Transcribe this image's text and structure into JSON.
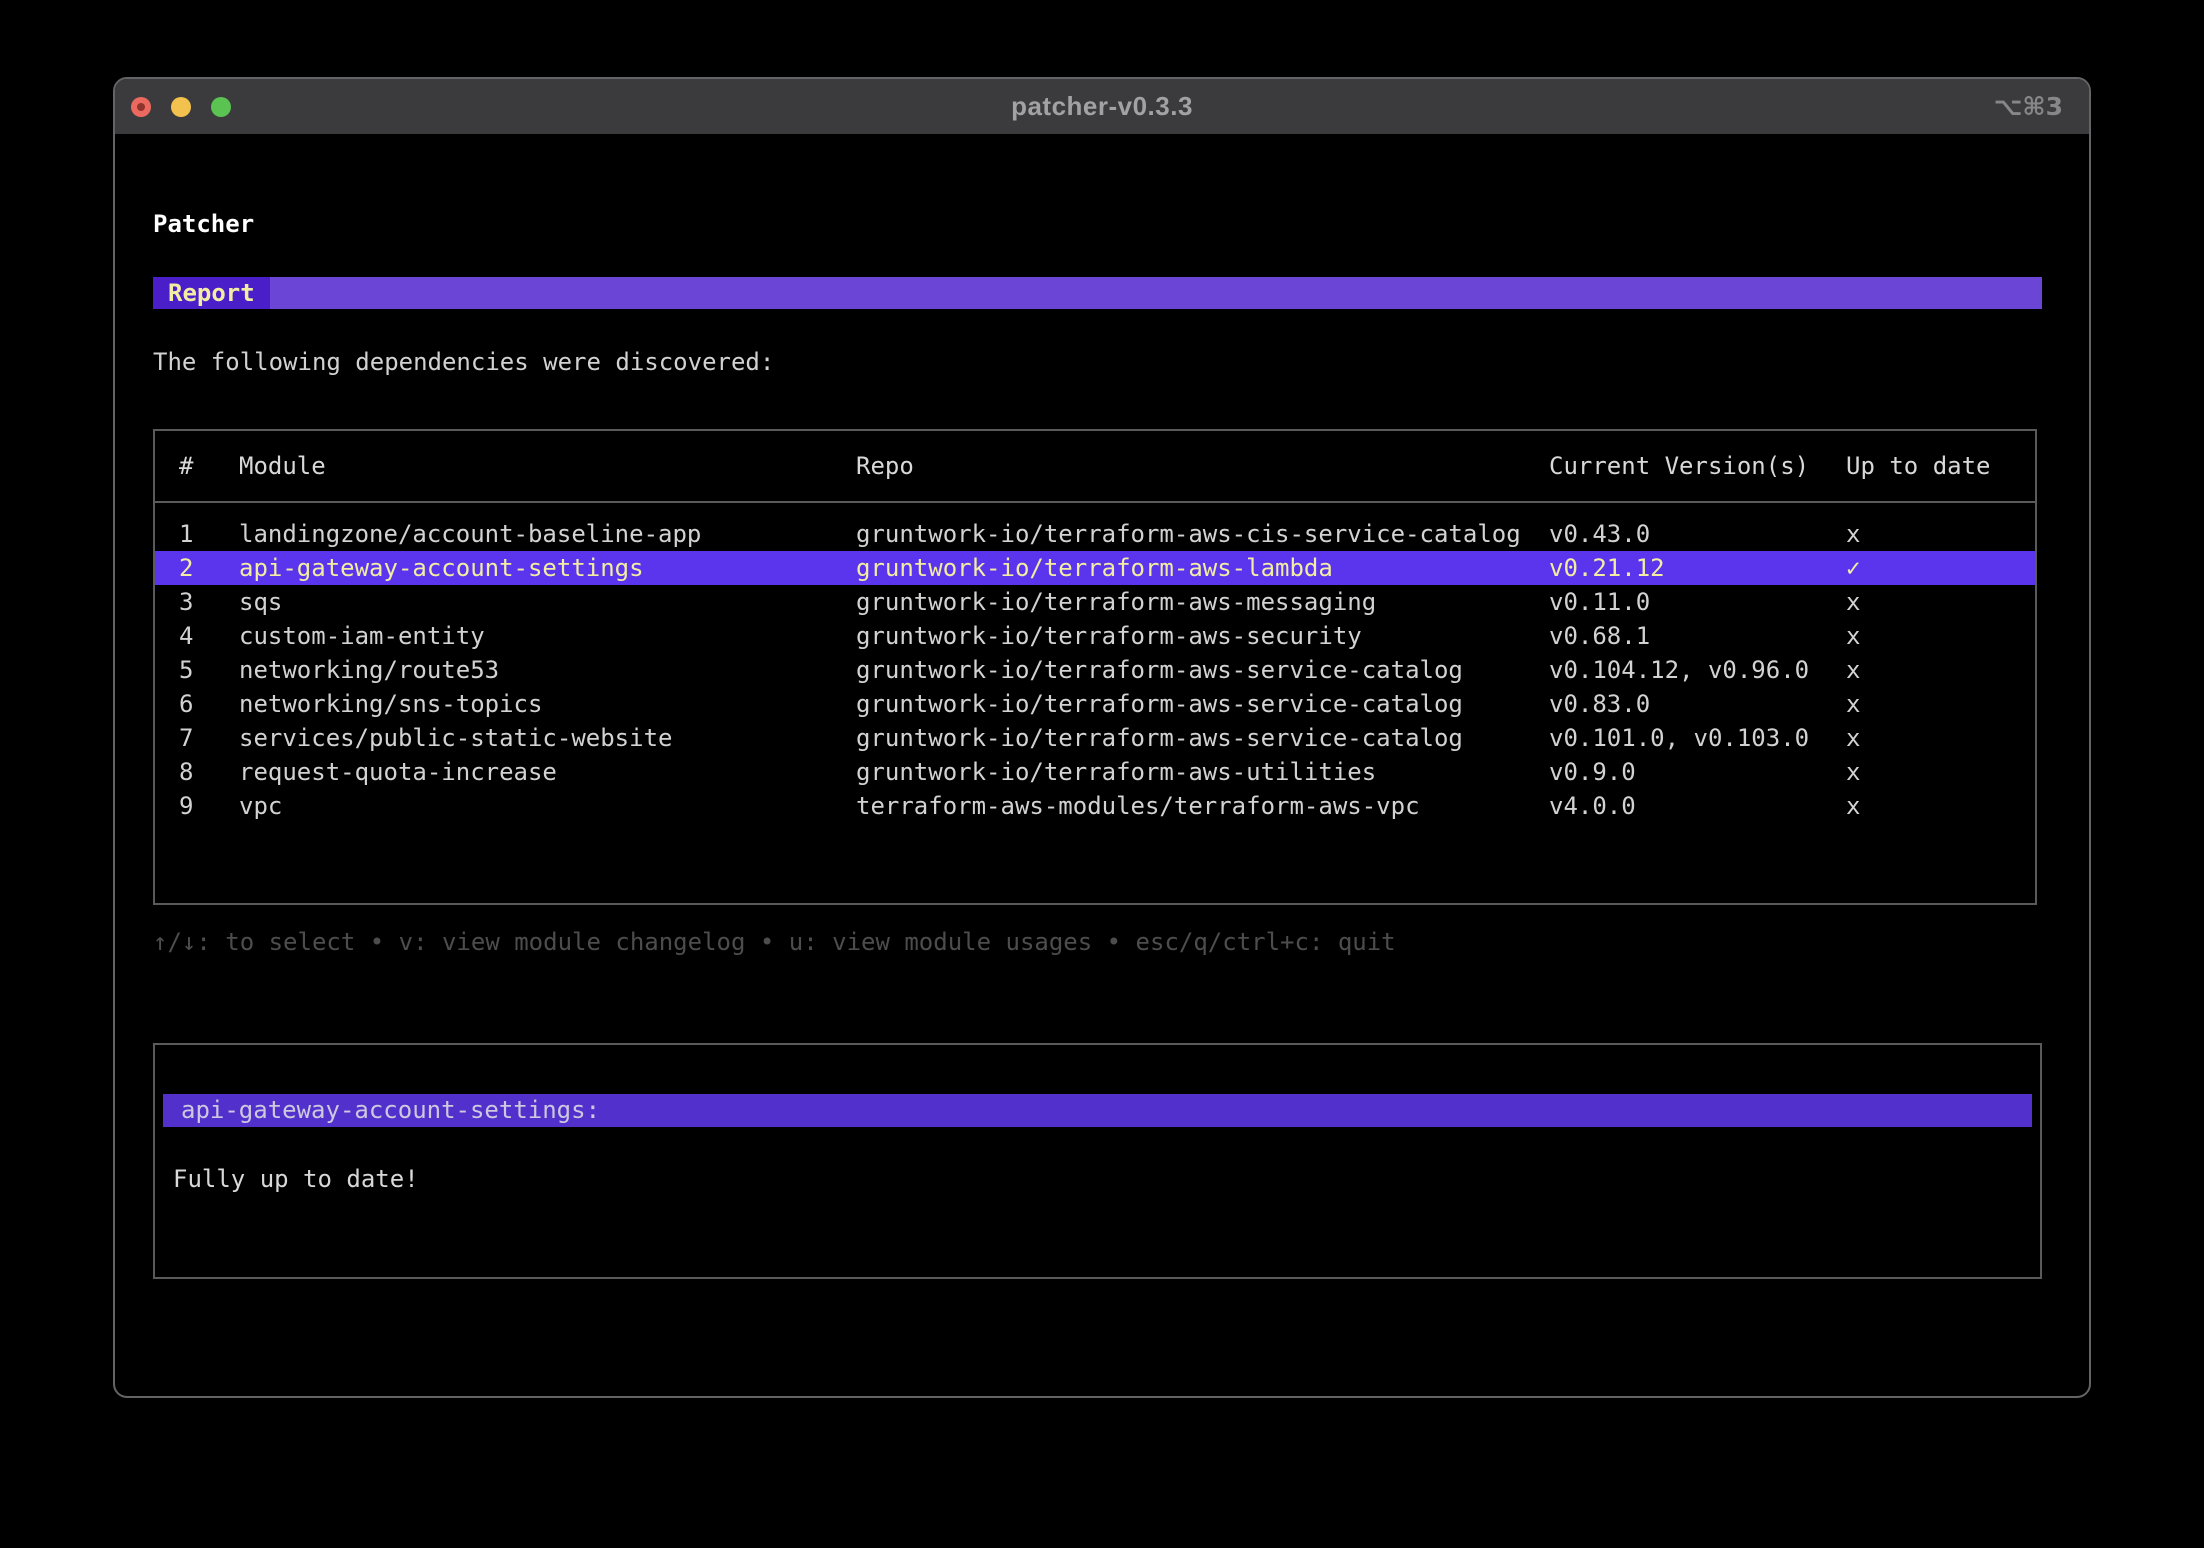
{
  "window": {
    "title": "patcher-v0.3.3",
    "shortcut": "⌥⌘3"
  },
  "app": {
    "heading": "Patcher",
    "tab_label": "Report",
    "intro": "The following dependencies were discovered:"
  },
  "table": {
    "headers": [
      "#",
      "Module",
      "Repo",
      "Current Version(s)",
      "Up to date"
    ],
    "rows": [
      {
        "num": "1",
        "module": "landingzone/account-baseline-app",
        "repo": "gruntwork-io/terraform-aws-cis-service-catalog",
        "versions": "v0.43.0",
        "up_to_date": "x",
        "selected": false
      },
      {
        "num": "2",
        "module": "api-gateway-account-settings",
        "repo": "gruntwork-io/terraform-aws-lambda",
        "versions": "v0.21.12",
        "up_to_date": "✓",
        "selected": true
      },
      {
        "num": "3",
        "module": "sqs",
        "repo": "gruntwork-io/terraform-aws-messaging",
        "versions": "v0.11.0",
        "up_to_date": "x",
        "selected": false
      },
      {
        "num": "4",
        "module": "custom-iam-entity",
        "repo": "gruntwork-io/terraform-aws-security",
        "versions": "v0.68.1",
        "up_to_date": "x",
        "selected": false
      },
      {
        "num": "5",
        "module": "networking/route53",
        "repo": "gruntwork-io/terraform-aws-service-catalog",
        "versions": "v0.104.12, v0.96.0",
        "up_to_date": "x",
        "selected": false
      },
      {
        "num": "6",
        "module": "networking/sns-topics",
        "repo": "gruntwork-io/terraform-aws-service-catalog",
        "versions": "v0.83.0",
        "up_to_date": "x",
        "selected": false
      },
      {
        "num": "7",
        "module": "services/public-static-website",
        "repo": "gruntwork-io/terraform-aws-service-catalog",
        "versions": "v0.101.0, v0.103.0",
        "up_to_date": "x",
        "selected": false
      },
      {
        "num": "8",
        "module": "request-quota-increase",
        "repo": "gruntwork-io/terraform-aws-utilities",
        "versions": "v0.9.0",
        "up_to_date": "x",
        "selected": false
      },
      {
        "num": "9",
        "module": "vpc",
        "repo": "terraform-aws-modules/terraform-aws-vpc",
        "versions": "v4.0.0",
        "up_to_date": "x",
        "selected": false
      }
    ]
  },
  "hints": "↑/↓: to select • v: view module changelog • u: view module usages • esc/q/ctrl+c: quit",
  "detail": {
    "heading": "api-gateway-account-settings:",
    "body": "Fully up to date!"
  },
  "colors": {
    "accent_tab": "#4a1ec8",
    "accent_banner": "#6b46d6",
    "row_highlight": "#5b35ee",
    "detail_highlight": "#5230cb",
    "highlight_text": "#f2eda2",
    "light_close": "#ec695f",
    "light_minimize": "#f3c14e",
    "light_zoom": "#5ac351"
  }
}
